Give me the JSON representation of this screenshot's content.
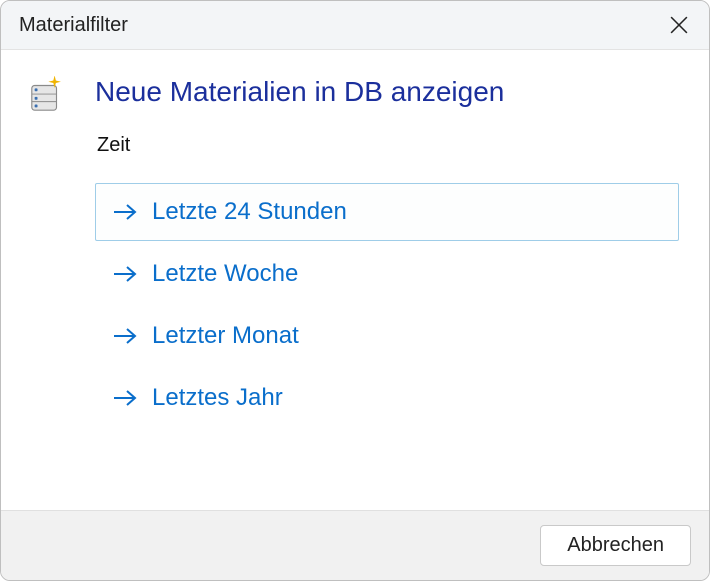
{
  "titlebar": {
    "title": "Materialfilter"
  },
  "heading": "Neue Materialien in DB anzeigen",
  "section_label": "Zeit",
  "options": [
    {
      "label": "Letzte 24 Stunden",
      "selected": true
    },
    {
      "label": "Letzte Woche",
      "selected": false
    },
    {
      "label": "Letzter Monat",
      "selected": false
    },
    {
      "label": "Letztes Jahr",
      "selected": false
    }
  ],
  "footer": {
    "cancel_label": "Abbrechen"
  },
  "colors": {
    "heading": "#1b2f9c",
    "link": "#0a6ecb"
  }
}
